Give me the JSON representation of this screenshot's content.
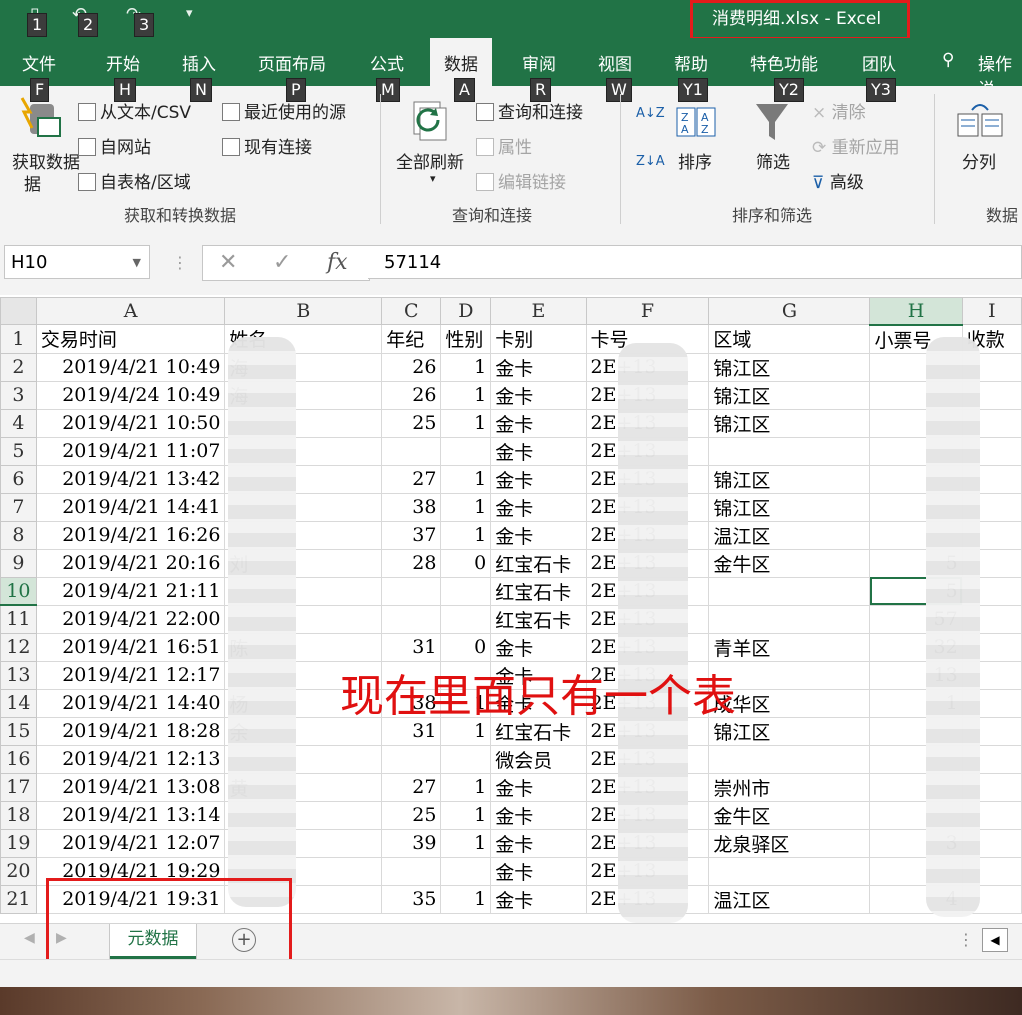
{
  "window": {
    "title": "消费明细.xlsx  -  Excel",
    "keytips_qat": [
      "1",
      "2",
      "3"
    ]
  },
  "ribbon_tabs": [
    {
      "label": "文件",
      "keytip": "F"
    },
    {
      "label": "开始",
      "keytip": "H"
    },
    {
      "label": "插入",
      "keytip": "N"
    },
    {
      "label": "页面布局",
      "keytip": "P"
    },
    {
      "label": "公式",
      "keytip": "M"
    },
    {
      "label": "数据",
      "keytip": "A",
      "active": true
    },
    {
      "label": "审阅",
      "keytip": "R"
    },
    {
      "label": "视图",
      "keytip": "W"
    },
    {
      "label": "帮助",
      "keytip": "Y1"
    },
    {
      "label": "特色功能",
      "keytip": "Y2"
    },
    {
      "label": "团队",
      "keytip": "Y3"
    },
    {
      "label": "操作说"
    }
  ],
  "ribbon": {
    "get_data": "获取数据",
    "get_data_2": "据",
    "from_text": "从文本/CSV",
    "from_web": "自网站",
    "from_table": "自表格/区域",
    "recent_sources": "最近使用的源",
    "existing_conn": "现有连接",
    "group_get": "获取和转换数据",
    "refresh_all": "全部刷新",
    "queries_conn": "查询和连接",
    "properties": "属性",
    "edit_links": "编辑链接",
    "group_query": "查询和连接",
    "sort_az": "A↓Z",
    "sort_za": "Z↓A",
    "sort": "排序",
    "filter": "筛选",
    "clear": "清除",
    "reapply": "重新应用",
    "advanced": "高级",
    "group_sort": "排序和筛选",
    "split": "分列",
    "group_data": "数据"
  },
  "formula_bar": {
    "name_box": "H10",
    "cancel": "✕",
    "enter": "✓",
    "fx": "fx",
    "value": "57114"
  },
  "columns": [
    "A",
    "B",
    "C",
    "D",
    "E",
    "F",
    "G",
    "H",
    "I"
  ],
  "rows": [
    {
      "n": "1",
      "A": "交易时间",
      "B": "姓名",
      "C": "年纪",
      "D": "性别",
      "E": "卡别",
      "F": "卡号",
      "G": "区域",
      "H": "小票号",
      "I": "收款"
    },
    {
      "n": "2",
      "A": "2019/4/21  10:49",
      "B": "海",
      "C": "26",
      "D": "1",
      "E": "金卡",
      "F": "2E+13",
      "G": "锦江区",
      "H": ""
    },
    {
      "n": "3",
      "A": "2019/4/24  10:49",
      "B": "海",
      "C": "26",
      "D": "1",
      "E": "金卡",
      "F": "2E+13",
      "G": "锦江区",
      "H": ""
    },
    {
      "n": "4",
      "A": "2019/4/21  10:50",
      "B": "",
      "C": "25",
      "D": "1",
      "E": "金卡",
      "F": "2E+13",
      "G": "锦江区",
      "H": ""
    },
    {
      "n": "5",
      "A": "2019/4/21  11:07",
      "B": "",
      "C": "",
      "D": "",
      "E": "金卡",
      "F": "2E+13",
      "G": "",
      "H": ""
    },
    {
      "n": "6",
      "A": "2019/4/21  13:42",
      "B": "",
      "C": "27",
      "D": "1",
      "E": "金卡",
      "F": "2E+13",
      "G": "锦江区",
      "H": ""
    },
    {
      "n": "7",
      "A": "2019/4/21  14:41",
      "B": "",
      "C": "38",
      "D": "1",
      "E": "金卡",
      "F": "2E+13",
      "G": "锦江区",
      "H": ""
    },
    {
      "n": "8",
      "A": "2019/4/21  16:26",
      "B": "",
      "C": "37",
      "D": "1",
      "E": "金卡",
      "F": "2E+13",
      "G": "温江区",
      "H": ""
    },
    {
      "n": "9",
      "A": "2019/4/21  20:16",
      "B": "刘",
      "C": "28",
      "D": "0",
      "E": "红宝石卡",
      "F": "2E+13",
      "G": "金牛区",
      "H": "5"
    },
    {
      "n": "10",
      "A": "2019/4/21  21:11",
      "B": "",
      "C": "",
      "D": "",
      "E": "红宝石卡",
      "F": "2E+13",
      "G": "",
      "H": "5"
    },
    {
      "n": "11",
      "A": "2019/4/21  22:00",
      "B": "",
      "C": "",
      "D": "",
      "E": "红宝石卡",
      "F": "2E+13",
      "G": "",
      "H": "57"
    },
    {
      "n": "12",
      "A": "2019/4/21  16:51",
      "B": "陈",
      "C": "31",
      "D": "0",
      "E": "金卡",
      "F": "2E+13",
      "G": "青羊区",
      "H": "32"
    },
    {
      "n": "13",
      "A": "2019/4/21  12:17",
      "B": "",
      "C": "",
      "D": "",
      "E": "金卡",
      "F": "2E+13",
      "G": "",
      "H": "13"
    },
    {
      "n": "14",
      "A": "2019/4/21  14:40",
      "B": "杨",
      "C": "38",
      "D": "1",
      "E": "金卡",
      "F": "2E+13",
      "G": "成华区",
      "H": "1"
    },
    {
      "n": "15",
      "A": "2019/4/21  18:28",
      "B": "余",
      "C": "31",
      "D": "1",
      "E": "红宝石卡",
      "F": "2E+13",
      "G": "锦江区",
      "H": ""
    },
    {
      "n": "16",
      "A": "2019/4/21  12:13",
      "B": "",
      "C": "",
      "D": "",
      "E": "微会员",
      "F": "2E+13",
      "G": "",
      "H": ""
    },
    {
      "n": "17",
      "A": "2019/4/21  13:08",
      "B": "黄",
      "C": "27",
      "D": "1",
      "E": "金卡",
      "F": "2E+13",
      "G": "崇州市",
      "H": ""
    },
    {
      "n": "18",
      "A": "2019/4/21  13:14",
      "B": "",
      "C": "25",
      "D": "1",
      "E": "金卡",
      "F": "2E+13",
      "G": "金牛区",
      "H": ""
    },
    {
      "n": "19",
      "A": "2019/4/21  12:07",
      "B": "",
      "C": "39",
      "D": "1",
      "E": "金卡",
      "F": "2E+13",
      "G": "龙泉驿区",
      "H": "3"
    },
    {
      "n": "20",
      "A": "2019/4/21  19:29",
      "B": "",
      "C": "",
      "D": "",
      "E": "金卡",
      "F": "2E+13",
      "G": "",
      "H": ""
    },
    {
      "n": "21",
      "A": "2019/4/21  19:31",
      "B": "",
      "C": "35",
      "D": "1",
      "E": "金卡",
      "F": "2E+13",
      "G": "温江区",
      "H": "4"
    }
  ],
  "annotation": "现在里面只有一个表",
  "sheets": [
    "元数据"
  ],
  "add_sheet": "+",
  "colors": {
    "excel_green": "#217346",
    "red": "#e31b1b"
  }
}
